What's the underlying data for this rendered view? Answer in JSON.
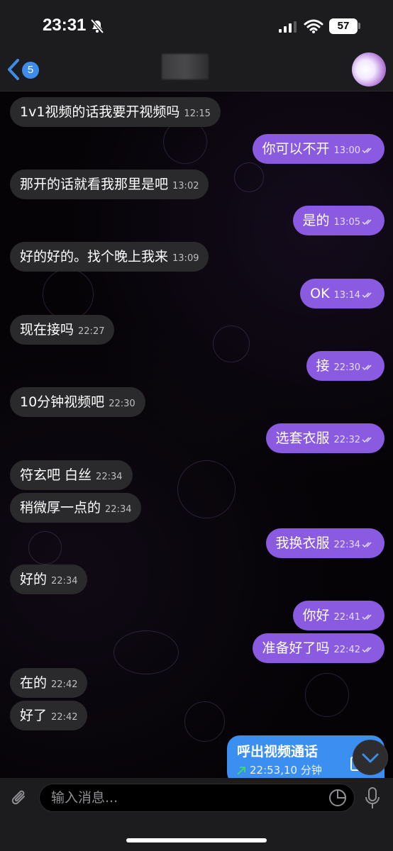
{
  "status_bar": {
    "time": "23:31",
    "battery": "57"
  },
  "nav": {
    "back_badge": "5"
  },
  "messages": [
    {
      "text": "1v1视频的话我要开视频吗",
      "time": "12:15"
    },
    {
      "text": "你可以不开",
      "time": "13:00"
    },
    {
      "text": "那开的话就看我那里是吧",
      "time": "13:02"
    },
    {
      "text": "是的",
      "time": "13:05"
    },
    {
      "text": "好的好的。找个晚上我来",
      "time": "13:09"
    },
    {
      "text": "OK",
      "time": "13:14"
    },
    {
      "text": "现在接吗",
      "time": "22:27"
    },
    {
      "text": "接",
      "time": "22:30"
    },
    {
      "text": "10分钟视频吧",
      "time": "22:30"
    },
    {
      "text": "选套衣服",
      "time": "22:32"
    },
    {
      "text": "符玄吧  白丝",
      "time": "22:34"
    },
    {
      "text": "稍微厚一点的",
      "time": "22:34"
    },
    {
      "text": "我换衣服",
      "time": "22:34"
    },
    {
      "text": "好的",
      "time": "22:34"
    },
    {
      "text": "你好",
      "time": "22:41"
    },
    {
      "text": "准备好了吗",
      "time": "22:42"
    },
    {
      "text": "在的",
      "time": "22:42"
    },
    {
      "text": "好了",
      "time": "22:42"
    }
  ],
  "call": {
    "title": "呼出视频通话",
    "info": "22:53,10 分钟"
  },
  "input": {
    "placeholder": "输入消息..."
  },
  "colors": {
    "outgoing": "#8a5be0",
    "incoming": "#2a2a2c",
    "call": "#3a8ff0",
    "accent": "#3d8de8"
  }
}
